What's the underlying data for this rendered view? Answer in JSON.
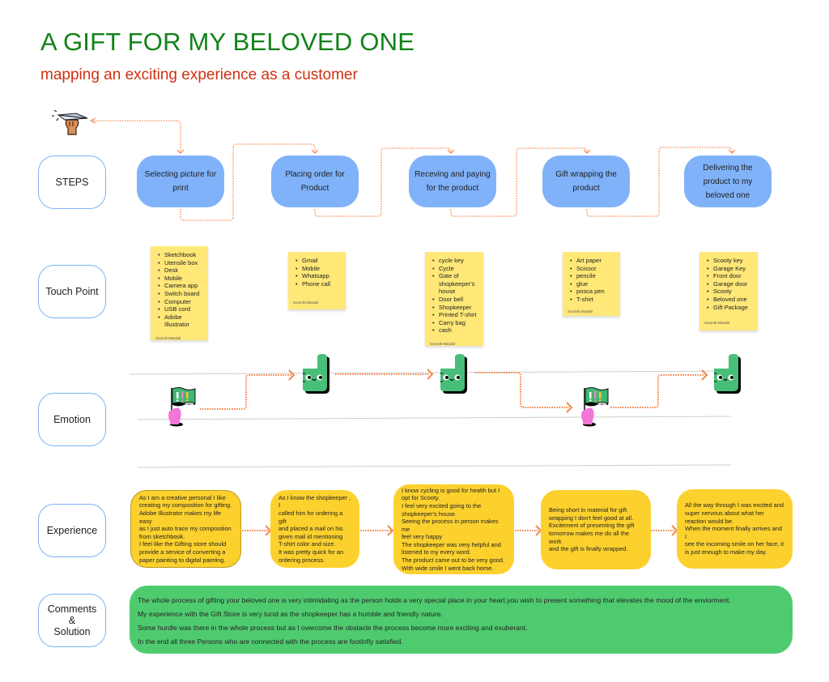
{
  "header": {
    "title": "A GIFT FOR MY BELOVED ONE",
    "subtitle": "mapping an exciting experience as a customer"
  },
  "colors": {
    "title": "#118218",
    "subtitle": "#d03010",
    "step_fill": "#80b2f9",
    "row_label_border": "#7fb2f7",
    "sticky": "#ffe878",
    "experience": "#fcd12e",
    "comments": "#4fcb6f",
    "connector": "#f5874d"
  },
  "row_labels": [
    {
      "label": "STEPS"
    },
    {
      "label": "Touch Point"
    },
    {
      "label": "Emotion"
    },
    {
      "label": "Experience"
    },
    {
      "label": "Comments\n&\nSolution"
    }
  ],
  "start_icon": "paper-plane-hand-icon",
  "steps": [
    {
      "label": "Selecting picture for print"
    },
    {
      "label": "Placing order for Product"
    },
    {
      "label": "Receving and paying for the product"
    },
    {
      "label": "Gift wrapping the product"
    },
    {
      "label": "Delivering the product to my beloved one"
    }
  ],
  "touch_points": [
    {
      "items": [
        "Sketchbook",
        "Utensile box",
        "Desk",
        "Mobile",
        "Camera app",
        "Switch board",
        "Computer",
        "USB cord",
        "Adobe Illustrator"
      ],
      "author": "Soumik Mandal"
    },
    {
      "items": [
        "Gmail",
        "Mobile",
        "Whatsapp",
        "Phone call"
      ],
      "author": "Soumik Mandal"
    },
    {
      "items": [
        "cycle key",
        "Cycle",
        "Gate of shopkeeper's house",
        "Door bell",
        "Shopkeeper",
        "Printed T-shirt",
        "Carry bag",
        "cash"
      ],
      "author": "Soumik Mandal"
    },
    {
      "items": [
        "Art paper",
        "Scissor",
        "pencile",
        "glue",
        "posca pen",
        "T-shirt"
      ],
      "author": "Soumik Mandal"
    },
    {
      "items": [
        "Scooty key",
        "Garage Key",
        "Front door",
        "Garage door",
        "Scooty",
        "Beloved one",
        "Gift Package"
      ],
      "author": "Soumik Mandal"
    }
  ],
  "emotions": [
    {
      "icon": "flag-hand-icon",
      "level": "neutral"
    },
    {
      "icon": "thumbs-up-icon",
      "level": "happy"
    },
    {
      "icon": "thumbs-up-icon",
      "level": "happy"
    },
    {
      "icon": "flag-hand-icon",
      "level": "neutral"
    },
    {
      "icon": "thumbs-up-icon",
      "level": "happy"
    }
  ],
  "experiences": [
    {
      "text": "As I am a creative personal I like\ncreating my composition for gifting.\nAdobe Illustrator makes my life easy\nas I just auto trace my composition\nfrom sketchbook.\nI feel like the Gifting store should\nprovide a service of converting a\npaper painting to digital painting."
    },
    {
      "text": "As I know the shopkeeper , I\ncalled him for ordering a gift\nand placed a mail on his\ngiven mail id mentioning\nT-shirt color and size.\nIt was pretty quick for an\nordering process."
    },
    {
      "text": "I know cycling is good for health but I\nopt for Scooty.\nI feel very excited going to the\nshopkeeper's house.\nSeeing the process in person makes me\nfeel very happy\nThe shopkeeper was very helpful and\nlistened to my every word.\nThe product came out to be very good.\nWith wide smile I went back home."
    },
    {
      "text": "Being short in material for gift\nwrapping I don't feel good at all.\nExcitement of presenting the gift\ntomorrow makes me do all the work\nand the gift is finally wrapped."
    },
    {
      "text": "All the way through I was excited and\nsuper nervous about what her\nreaction would be.\nWhen the moment finally arrives and I\nsee the incoming smile on her face, it\nis just enough to make my day."
    }
  ],
  "comments": [
    "The whole process of gifting your beloved one is very intimidating as the person holds a very special place in your heart,you wish to present something that elevates the mood of the enviorment.",
    "My experience with the Gift Store is very lucid as the shopkeeper has a humble and friendly nature.",
    "Some hurdle was there in the whole process but as I overcome the obstacle the process become more exciting and exuberant.",
    "In the end all three Persons who are connected with the process are footinfly satisfied."
  ]
}
